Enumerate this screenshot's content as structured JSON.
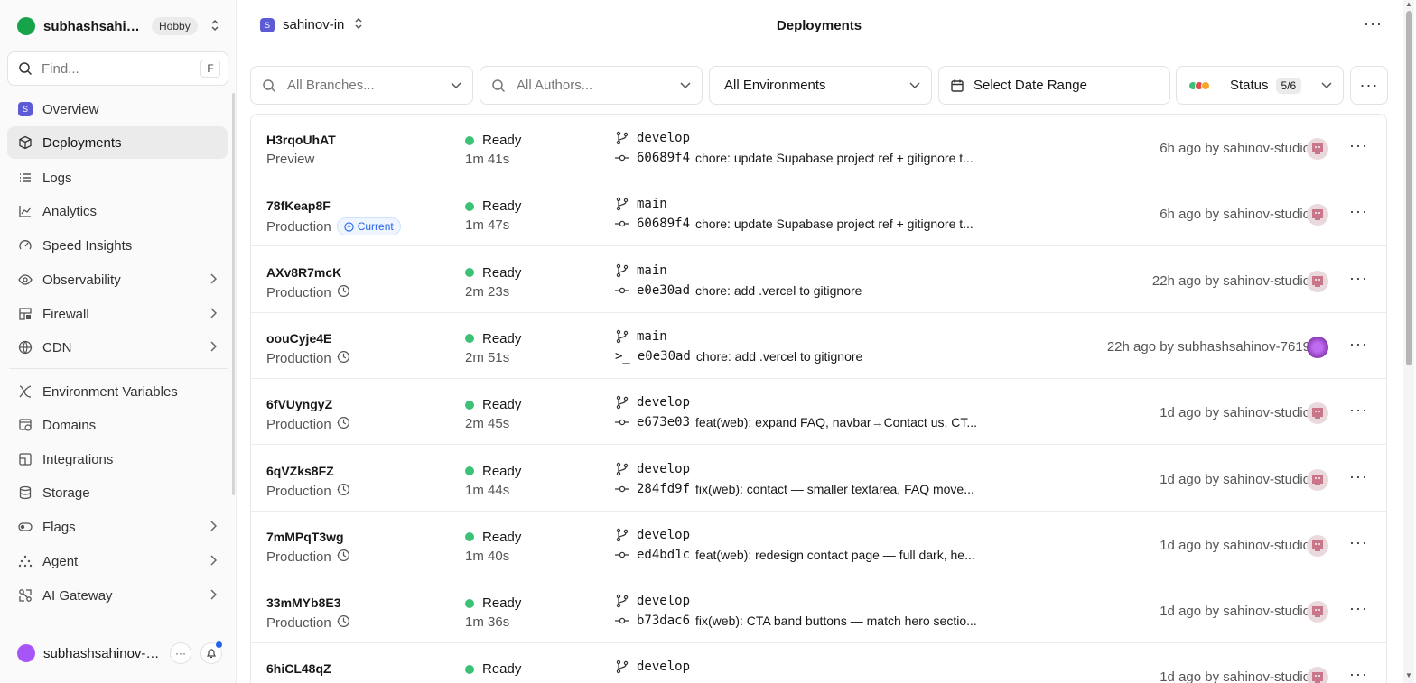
{
  "team": {
    "name": "subhashsahino...",
    "plan": "Hobby"
  },
  "search": {
    "placeholder": "Find...",
    "shortcut": "F"
  },
  "sidebar": {
    "items": [
      {
        "label": "Overview",
        "icon": "project-square-icon"
      },
      {
        "label": "Deployments",
        "icon": "cube-icon",
        "active": true
      },
      {
        "label": "Logs",
        "icon": "list-icon"
      },
      {
        "label": "Analytics",
        "icon": "chart-line-icon"
      },
      {
        "label": "Speed Insights",
        "icon": "gauge-icon"
      },
      {
        "label": "Observability",
        "icon": "eye-icon",
        "chevron": true
      },
      {
        "label": "Firewall",
        "icon": "firewall-icon",
        "chevron": true
      },
      {
        "label": "CDN",
        "icon": "globe-icon",
        "chevron": true
      },
      {
        "label": "Environment Variables",
        "icon": "variables-icon"
      },
      {
        "label": "Domains",
        "icon": "domains-icon"
      },
      {
        "label": "Integrations",
        "icon": "integrations-icon"
      },
      {
        "label": "Storage",
        "icon": "database-icon"
      },
      {
        "label": "Flags",
        "icon": "toggle-icon",
        "chevron": true
      },
      {
        "label": "Agent",
        "icon": "agent-icon",
        "chevron": true
      },
      {
        "label": "AI Gateway",
        "icon": "gateway-icon",
        "chevron": true
      }
    ]
  },
  "user": {
    "name": "subhashsahinov-7..."
  },
  "header": {
    "project": "sahinov-in",
    "project_initial": "S",
    "title": "Deployments"
  },
  "filters": {
    "branches_placeholder": "All Branches...",
    "authors_placeholder": "All Authors...",
    "environments": "All Environments",
    "date_range": "Select Date Range",
    "status_label": "Status",
    "status_count": "5/6"
  },
  "colors": {
    "ready": "#3cc276",
    "accent": "#2563eb",
    "status_dots": [
      "#3cc276",
      "#e5484d",
      "#f5a623"
    ]
  },
  "deployments": [
    {
      "id": "H3rqoUhAT",
      "env": "Preview",
      "status": "Ready",
      "duration": "1m 41s",
      "branch": "develop",
      "commit_hash": "60689f4",
      "commit_msg": "chore: update Supabase project ref + gitignore t...",
      "time_by": "6h ago by sahinov-studio"
    },
    {
      "id": "78fKeap8F",
      "env": "Production",
      "current": "Current",
      "status": "Ready",
      "duration": "1m 47s",
      "branch": "main",
      "commit_hash": "60689f4",
      "commit_msg": "chore: update Supabase project ref + gitignore t...",
      "time_by": "6h ago by sahinov-studio"
    },
    {
      "id": "AXv8R7mcK",
      "env": "Production",
      "status": "Ready",
      "duration": "2m 23s",
      "branch": "main",
      "commit_hash": "e0e30ad",
      "commit_msg": "chore: add .vercel to gitignore",
      "time_by": "22h ago by sahinov-studio"
    },
    {
      "id": "oouCyje4E",
      "env": "Production",
      "status": "Ready",
      "duration": "2m 51s",
      "branch": "main",
      "commit_hash": "e0e30ad",
      "commit_msg": "chore: add .vercel to gitignore",
      "time_by": "22h ago by subhashsahinov-7619",
      "cli": true
    },
    {
      "id": "6fVUyngyZ",
      "env": "Production",
      "status": "Ready",
      "duration": "2m 45s",
      "branch": "develop",
      "commit_hash": "e673e03",
      "commit_msg": "feat(web): expand FAQ, navbar→Contact us, CT...",
      "time_by": "1d ago by sahinov-studio"
    },
    {
      "id": "6qVZks8FZ",
      "env": "Production",
      "status": "Ready",
      "duration": "1m 44s",
      "branch": "develop",
      "commit_hash": "284fd9f",
      "commit_msg": "fix(web): contact — smaller textarea, FAQ move...",
      "time_by": "1d ago by sahinov-studio"
    },
    {
      "id": "7mMPqT3wg",
      "env": "Production",
      "status": "Ready",
      "duration": "1m 40s",
      "branch": "develop",
      "commit_hash": "ed4bd1c",
      "commit_msg": "feat(web): redesign contact page — full dark, he...",
      "time_by": "1d ago by sahinov-studio"
    },
    {
      "id": "33mMYb8E3",
      "env": "Production",
      "status": "Ready",
      "duration": "1m 36s",
      "branch": "develop",
      "commit_hash": "b73dac6",
      "commit_msg": "fix(web): CTA band buttons — match hero sectio...",
      "time_by": "1d ago by sahinov-studio"
    },
    {
      "id": "6hiCL48qZ",
      "env": "",
      "status": "Ready",
      "duration": "",
      "branch": "develop",
      "commit_hash": "",
      "commit_msg": "",
      "time_by": "1d ago by sahinov-studio"
    }
  ]
}
